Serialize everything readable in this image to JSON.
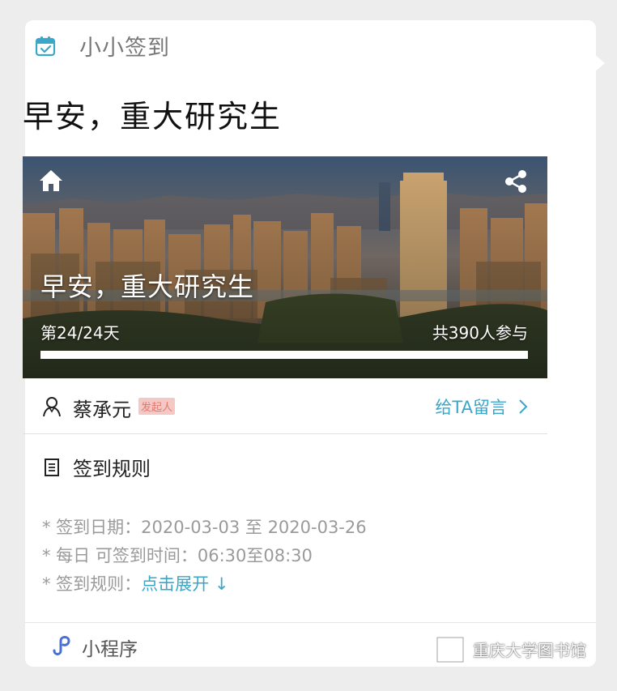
{
  "app": {
    "name": "小小签到"
  },
  "greeting": "早安，重大研究生",
  "banner": {
    "title": "早安，重大研究生",
    "day_progress": "第24/24天",
    "participants": "共390人参与",
    "progress_fraction": 1.0
  },
  "author": {
    "name": "蔡承元",
    "badge": "发起人",
    "message_link": "给TA留言"
  },
  "rules": {
    "title": "签到规则",
    "date_line": "* 签到日期：2020-03-03 至 2020-03-26",
    "time_line": "* 每日 可签到时间：06:30至08:30",
    "rules_prefix": "* 签到规则：",
    "expand_link": "点击展开 ↓"
  },
  "footer": {
    "label": "小程序",
    "watermark": "重庆大学图书馆"
  },
  "colors": {
    "accent": "#3aa7c9",
    "badge_bg": "#f4c9c5",
    "badge_text": "#e07a70"
  },
  "icons": [
    "calendar-check-icon",
    "home-icon",
    "share-icon",
    "person-icon",
    "chevron-right-icon",
    "document-icon",
    "mini-program-icon",
    "library-logo-icon"
  ]
}
